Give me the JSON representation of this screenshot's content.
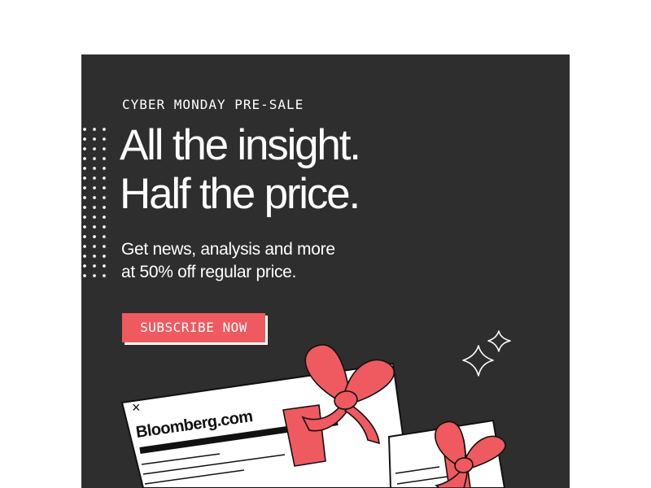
{
  "ad": {
    "eyebrow": "CYBER MONDAY PRE-SALE",
    "headline": [
      "All the insight.",
      "Half the price."
    ],
    "subtext": [
      "Get news, analysis and more",
      "at 50% off regular price."
    ],
    "cta_label": "SUBSCRIBE NOW"
  },
  "illustration": {
    "browser_logo": "Bloomberg.com",
    "close_glyph": "×"
  },
  "colors": {
    "background": "#2e2e2e",
    "accent": "#ee5a5f",
    "text": "#ffffff"
  },
  "icons": [
    "close-icon",
    "sparkle-icon",
    "gift-ribbon-icon"
  ]
}
